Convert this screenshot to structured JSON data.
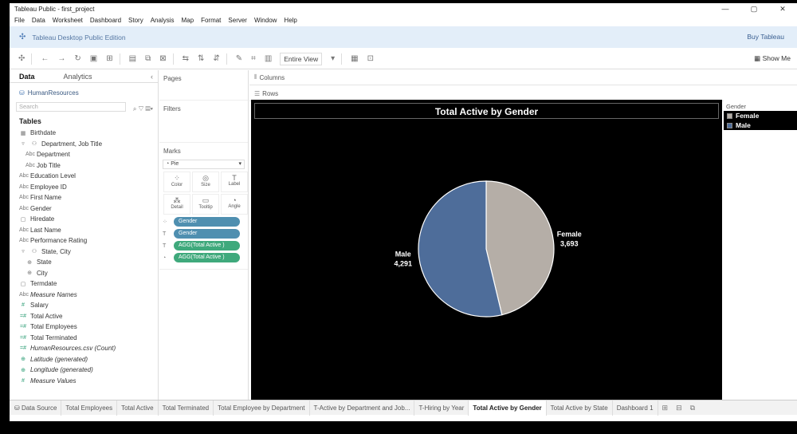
{
  "window": {
    "title": "Tableau Public - first_project",
    "controls": [
      "—",
      "▢",
      "✕"
    ]
  },
  "menu": [
    "File",
    "Data",
    "Worksheet",
    "Dashboard",
    "Story",
    "Analysis",
    "Map",
    "Format",
    "Server",
    "Window",
    "Help"
  ],
  "brand": {
    "name": "Tableau Desktop Public Edition",
    "buy": "Buy Tableau"
  },
  "toolbar": {
    "fit": "Entire View",
    "show_me": "Show Me"
  },
  "data_pane": {
    "tab_data": "Data",
    "tab_analytics": "Analytics",
    "source": "HumanResources",
    "search_placeholder": "Search",
    "tables_heading": "Tables",
    "fields": [
      {
        "label": "Birthdate",
        "icon": "▦",
        "level": 0
      },
      {
        "label": "Department, Job Title",
        "icon": "⚇",
        "level": 0
      },
      {
        "label": "Department",
        "icon": "Abc",
        "level": 1
      },
      {
        "label": "Job Title",
        "icon": "Abc",
        "level": 1
      },
      {
        "label": "Education Level",
        "icon": "Abc",
        "level": 0
      },
      {
        "label": "Employee ID",
        "icon": "Abc",
        "level": 0
      },
      {
        "label": "First Name",
        "icon": "Abc",
        "level": 0
      },
      {
        "label": "Gender",
        "icon": "Abc",
        "level": 0
      },
      {
        "label": "Hiredate",
        "icon": "▢",
        "level": 0
      },
      {
        "label": "Last Name",
        "icon": "Abc",
        "level": 0
      },
      {
        "label": "Performance Rating",
        "icon": "Abc",
        "level": 0
      },
      {
        "label": "State, City",
        "icon": "⚇",
        "level": 0
      },
      {
        "label": "State",
        "icon": "⊕",
        "level": 1
      },
      {
        "label": "City",
        "icon": "⊕",
        "level": 1
      },
      {
        "label": "Termdate",
        "icon": "▢",
        "level": 0
      },
      {
        "label": "Measure Names",
        "icon": "Abc",
        "level": 0,
        "italic": true
      },
      {
        "label": "Salary",
        "icon": "#",
        "level": 0,
        "measure": true
      },
      {
        "label": "Total Active",
        "icon": "=#",
        "level": 0,
        "measure": true
      },
      {
        "label": "Total Employees",
        "icon": "=#",
        "level": 0,
        "measure": true
      },
      {
        "label": "Total Terminated",
        "icon": "=#",
        "level": 0,
        "measure": true
      },
      {
        "label": "HumanResources.csv (Count)",
        "icon": "=#",
        "level": 0,
        "measure": true,
        "italic": true
      },
      {
        "label": "Latitude (generated)",
        "icon": "⊕",
        "level": 0,
        "measure": true,
        "italic": true
      },
      {
        "label": "Longitude (generated)",
        "icon": "⊕",
        "level": 0,
        "measure": true,
        "italic": true
      },
      {
        "label": "Measure Values",
        "icon": "#",
        "level": 0,
        "measure": true,
        "italic": true
      }
    ]
  },
  "cards": {
    "pages": "Pages",
    "filters": "Filters",
    "marks": "Marks",
    "mark_type": "Pie",
    "mark_buttons": [
      {
        "label": "Color",
        "icon": "⁘"
      },
      {
        "label": "Size",
        "icon": "◎"
      },
      {
        "label": "Label",
        "icon": "T"
      },
      {
        "label": "Detail",
        "icon": "⁂"
      },
      {
        "label": "Tooltip",
        "icon": "▭"
      },
      {
        "label": "Angle",
        "icon": "◔"
      }
    ],
    "pills": [
      {
        "icon": "⁘",
        "label": "Gender",
        "kind": "dim"
      },
      {
        "icon": "T",
        "label": "Gender",
        "kind": "dim"
      },
      {
        "icon": "T",
        "label": "AGG(Total Active )",
        "kind": "mea"
      },
      {
        "icon": "◔",
        "label": "AGG(Total Active )",
        "kind": "mea"
      }
    ]
  },
  "shelves": {
    "columns": "Columns",
    "rows": "Rows"
  },
  "legend": {
    "title": "Gender",
    "items": [
      {
        "label": "Female",
        "color": "#b5aea7"
      },
      {
        "label": "Male",
        "color": "#4e6d9a"
      }
    ]
  },
  "chart_data": {
    "type": "pie",
    "title": "Total Active by Gender",
    "categories": [
      "Male",
      "Female"
    ],
    "values": [
      4291,
      3693
    ],
    "value_labels": [
      "4,291",
      "3,693"
    ],
    "colors": [
      "#4e6d9a",
      "#b5aea7"
    ],
    "legend_position": "right"
  },
  "sheet_tabs": [
    {
      "label": "Data Source",
      "active": false
    },
    {
      "label": "Total Employees",
      "active": false
    },
    {
      "label": "Total Active",
      "active": false
    },
    {
      "label": "Total Terminated",
      "active": false
    },
    {
      "label": "Total Employee by Department",
      "active": false
    },
    {
      "label": "T-Active by Department and Job...",
      "active": false
    },
    {
      "label": "T-Hiring by Year",
      "active": false
    },
    {
      "label": "Total Active by Gender",
      "active": true
    },
    {
      "label": "Total Active by State",
      "active": false
    },
    {
      "label": "Dashboard 1",
      "active": false
    }
  ]
}
